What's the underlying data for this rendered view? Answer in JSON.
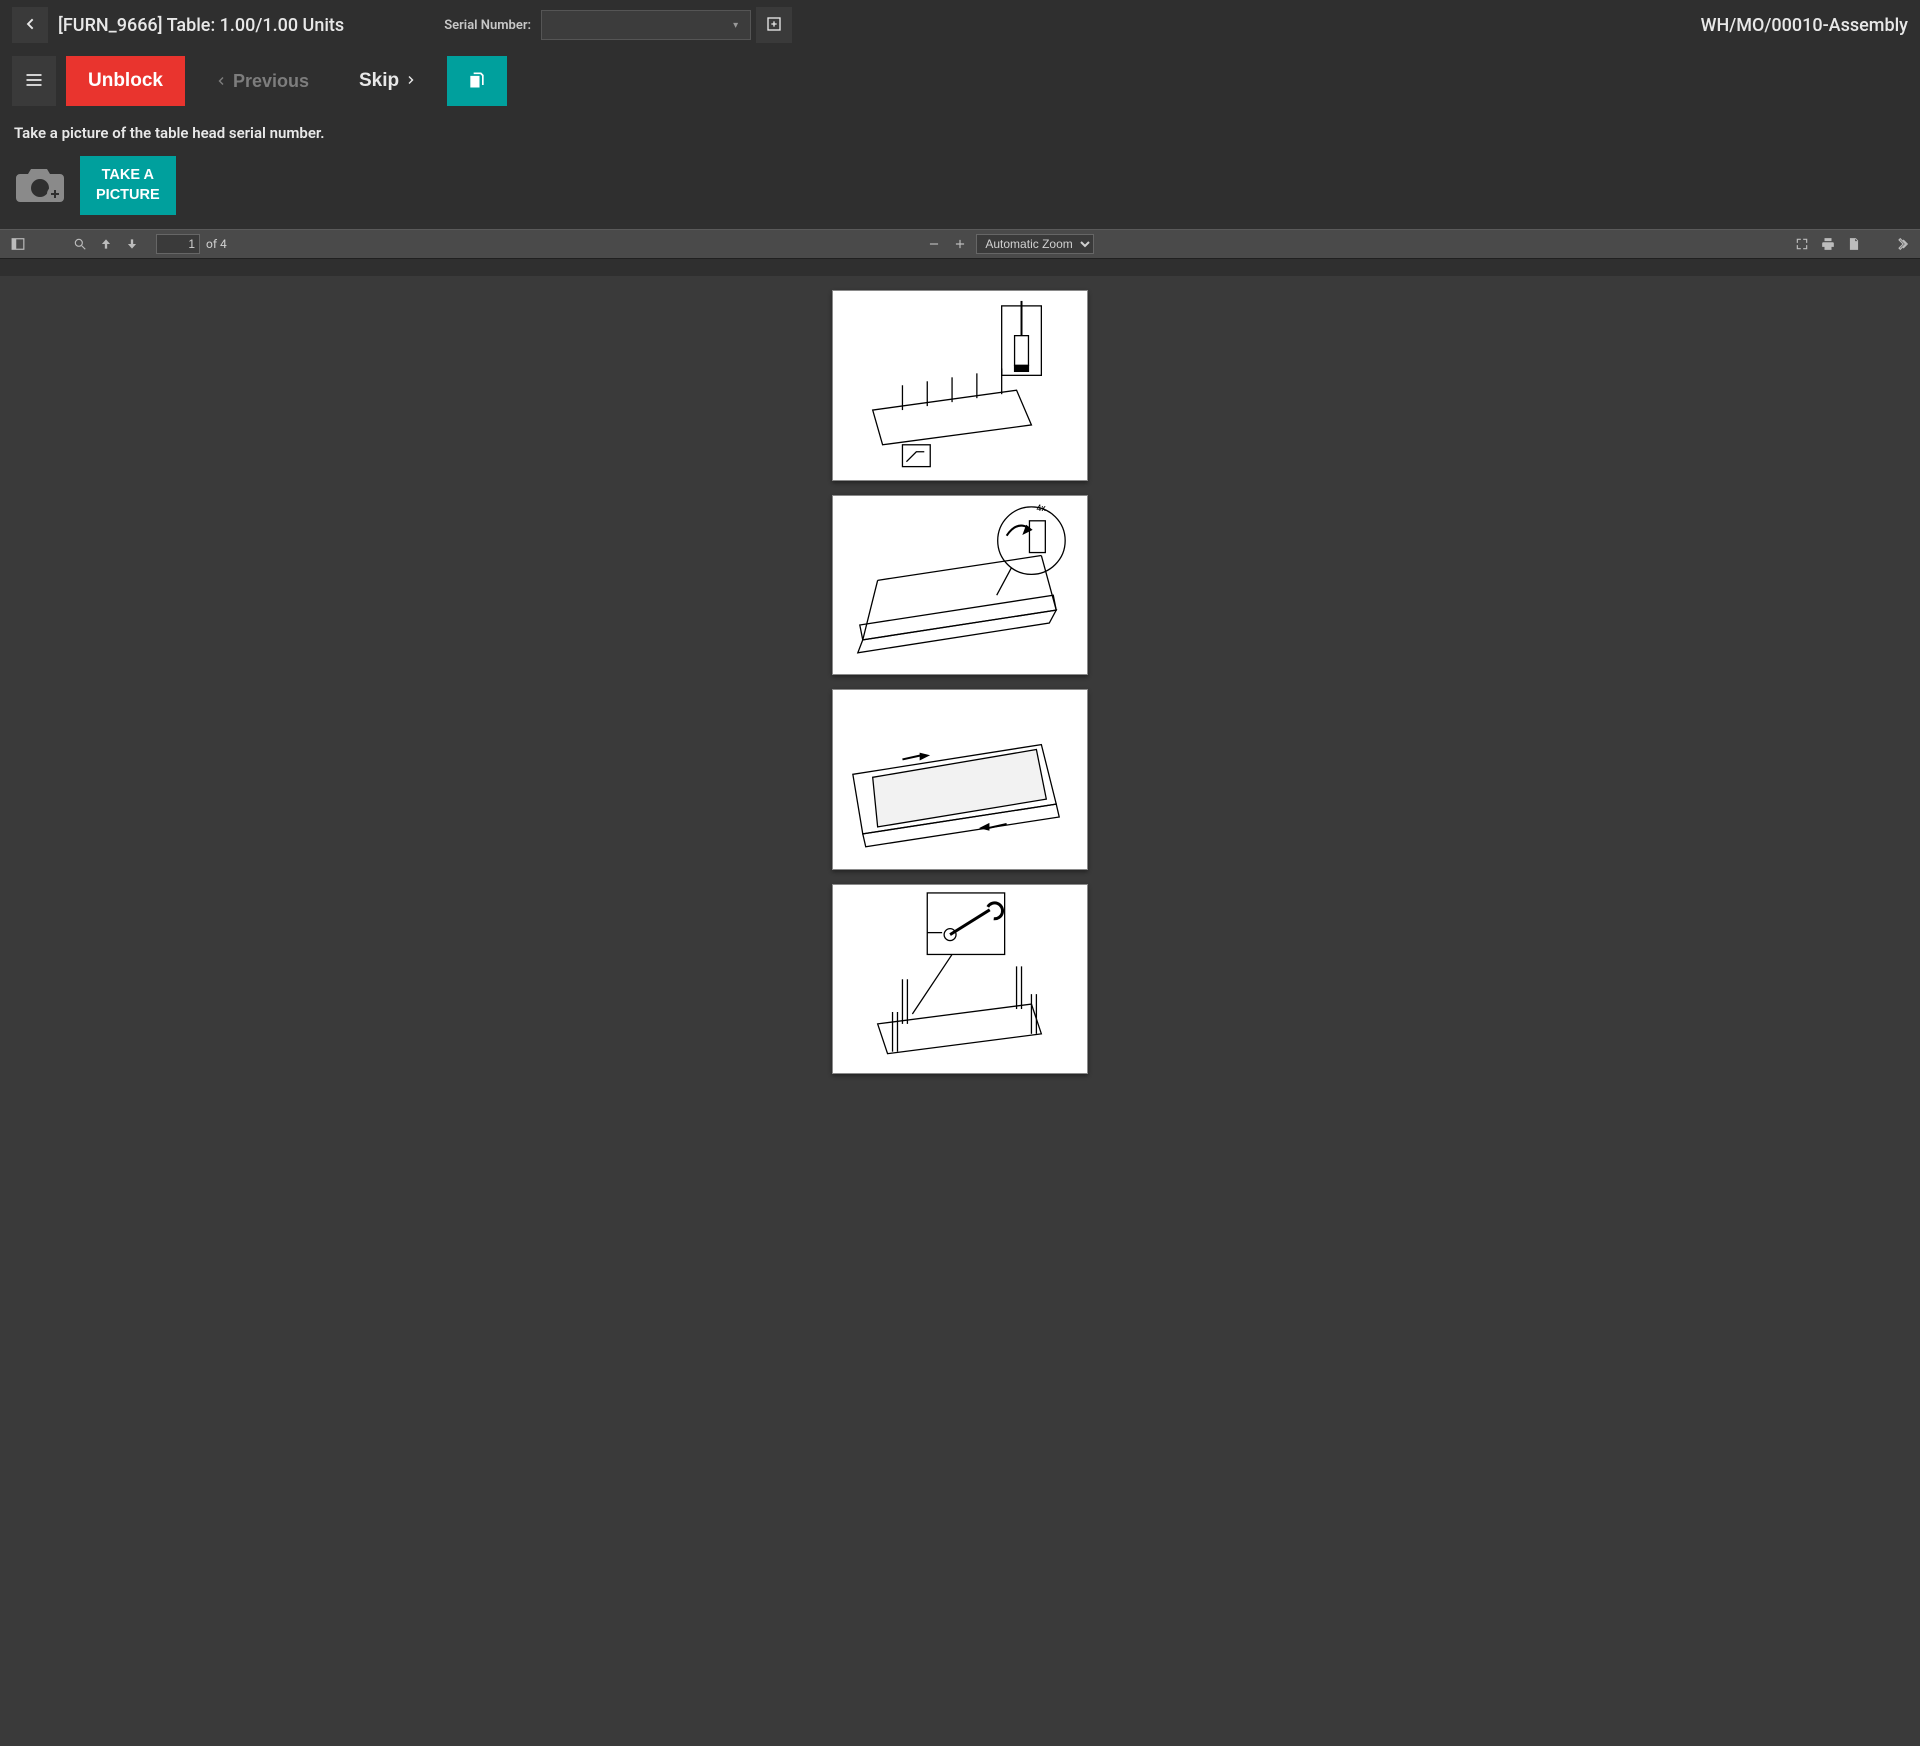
{
  "header": {
    "title": "[FURN_9666] Table: 1.00/1.00 Units",
    "serial_label": "Serial Number:",
    "serial_value": "",
    "right_title": "WH/MO/00010-Assembly"
  },
  "actions": {
    "unblock": "Unblock",
    "previous": "Previous",
    "skip": "Skip"
  },
  "instruction": "Take a picture of the table head serial number.",
  "take_picture": "TAKE A\nPICTURE",
  "pdf": {
    "page_current": "1",
    "page_total_label": "of 4",
    "zoom": "Automatic Zoom"
  }
}
